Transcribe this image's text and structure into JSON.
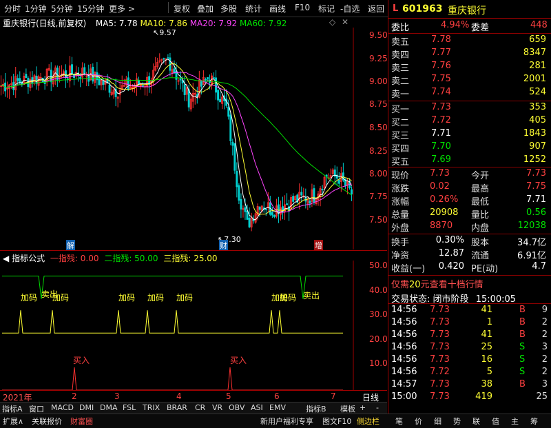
{
  "toolbar": {
    "items": [
      "分时",
      "1分钟",
      "5分钟",
      "15分钟",
      "更多 >",
      "复权",
      "叠加",
      "多股",
      "统计",
      "画线",
      "F10",
      "标记",
      "-自选",
      "返回"
    ]
  },
  "chart_title": {
    "stock": "重庆银行(日线,前复权)",
    "ma5_label": "MA5: 7.78",
    "ma10_label": "MA10: 7.86",
    "ma20_label": "MA20: 7.92",
    "ma60_label": "MA60: 7.92"
  },
  "indicator_title": {
    "name": "指标公式",
    "line1": "一指残: 0.00",
    "line2": "二指残: 50.00",
    "line3": "三指残: 25.00"
  },
  "price_axis": [
    "9.50",
    "9.25",
    "9.00",
    "8.75",
    "8.50",
    "8.25",
    "8.00",
    "7.75",
    "7.50"
  ],
  "indicator_axis": [
    "50.00",
    "40.00",
    "30.00",
    "20.00",
    "10.00"
  ],
  "annotations": {
    "high": "9.57",
    "low": "7.30",
    "tag_jie": "解",
    "tag_cai": "财",
    "tag_zeng": "增"
  },
  "signals": {
    "jiama": "加码",
    "maichu": "卖出",
    "mairu": "买入"
  },
  "date_axis": {
    "year": "2021年",
    "months": [
      "2",
      "3",
      "4",
      "5",
      "6",
      "7"
    ],
    "period": "日线"
  },
  "chart_data": {
    "type": "candlestick",
    "title": "重庆银行(日线,前复权)",
    "ylim": [
      7.3,
      9.6
    ],
    "series": [
      {
        "name": "MA5",
        "last": 7.78
      },
      {
        "name": "MA10",
        "last": 7.86
      },
      {
        "name": "MA20",
        "last": 7.92
      },
      {
        "name": "MA60",
        "last": 7.92
      }
    ],
    "period_high": 9.57,
    "period_low": 7.3
  },
  "quote": {
    "code": "601963",
    "name": "重庆银行",
    "weibi_label": "委比",
    "weibi": "4.94%",
    "weicha_label": "委差",
    "weicha": "448",
    "asks": [
      {
        "label": "卖五",
        "price": "7.78",
        "vol": "659"
      },
      {
        "label": "卖四",
        "price": "7.77",
        "vol": "8347"
      },
      {
        "label": "卖三",
        "price": "7.76",
        "vol": "281"
      },
      {
        "label": "卖二",
        "price": "7.75",
        "vol": "2001"
      },
      {
        "label": "卖一",
        "price": "7.74",
        "vol": "524"
      }
    ],
    "bids": [
      {
        "label": "买一",
        "price": "7.73",
        "vol": "353"
      },
      {
        "label": "买二",
        "price": "7.72",
        "vol": "405"
      },
      {
        "label": "买三",
        "price": "7.71",
        "vol": "1843"
      },
      {
        "label": "买四",
        "price": "7.70",
        "vol": "907"
      },
      {
        "label": "买五",
        "price": "7.69",
        "vol": "1252"
      }
    ],
    "stats1": [
      {
        "l1": "现价",
        "v1": "7.73",
        "l2": "今开",
        "v2": "7.73"
      },
      {
        "l1": "涨跌",
        "v1": "0.02",
        "l2": "最高",
        "v2": "7.75"
      },
      {
        "l1": "涨幅",
        "v1": "0.26%",
        "l2": "最低",
        "v2": "7.71"
      },
      {
        "l1": "总量",
        "v1": "20908",
        "l2": "量比",
        "v2": "0.56"
      },
      {
        "l1": "外盘",
        "v1": "8870",
        "l2": "内盘",
        "v2": "12038"
      }
    ],
    "stats2": [
      {
        "l1": "换手",
        "v1": "0.30%",
        "l2": "股本",
        "v2": "34.7亿"
      },
      {
        "l1": "净资",
        "v1": "12.87",
        "l2": "流通",
        "v2": "6.91亿"
      },
      {
        "l1": "收益(一)",
        "v1": "0.420",
        "l2": "PE(动)",
        "v2": "4.7"
      }
    ],
    "promo_pre": "仅需",
    "promo_num": "20",
    "promo_post": "元查看十档行情",
    "status_label": "交易状态:",
    "status_value": "闭市阶段",
    "status_time": "15:00:05",
    "ticks": [
      {
        "time": "14:56",
        "price": "7.73",
        "vol": "41",
        "side": "B"
      },
      {
        "time": "14:56",
        "price": "7.73",
        "vol": "1",
        "side": "B"
      },
      {
        "time": "14:56",
        "price": "7.73",
        "vol": "41",
        "side": "B"
      },
      {
        "time": "14:56",
        "price": "7.73",
        "vol": "25",
        "side": "S"
      },
      {
        "time": "14:56",
        "price": "7.73",
        "vol": "16",
        "side": "S"
      },
      {
        "time": "14:56",
        "price": "7.72",
        "vol": "5",
        "side": "S"
      },
      {
        "time": "14:57",
        "price": "7.73",
        "vol": "38",
        "side": "B"
      },
      {
        "time": "15:00",
        "price": "7.73",
        "vol": "419",
        "side": ""
      }
    ],
    "tick_extras": [
      "9",
      "2",
      "2",
      "3",
      "2",
      "2",
      "3",
      "25"
    ]
  },
  "indicator_tabs": [
    "指标A",
    "窗口",
    "MACD",
    "DMI",
    "DMA",
    "FSL",
    "TRIX",
    "BRAR",
    "CR",
    "VR",
    "OBV",
    "ASI",
    "EMV",
    "指标B",
    "模板",
    "+",
    "-"
  ],
  "bottom_bar": {
    "left": [
      "扩展∧",
      "关联报价",
      "财富圈"
    ],
    "right": [
      "新用户福利专享",
      "图文F10",
      "侧边栏"
    ],
    "side_icons": [
      "笔",
      "价",
      "细",
      "势",
      "联",
      "值",
      "主",
      "筹"
    ]
  }
}
